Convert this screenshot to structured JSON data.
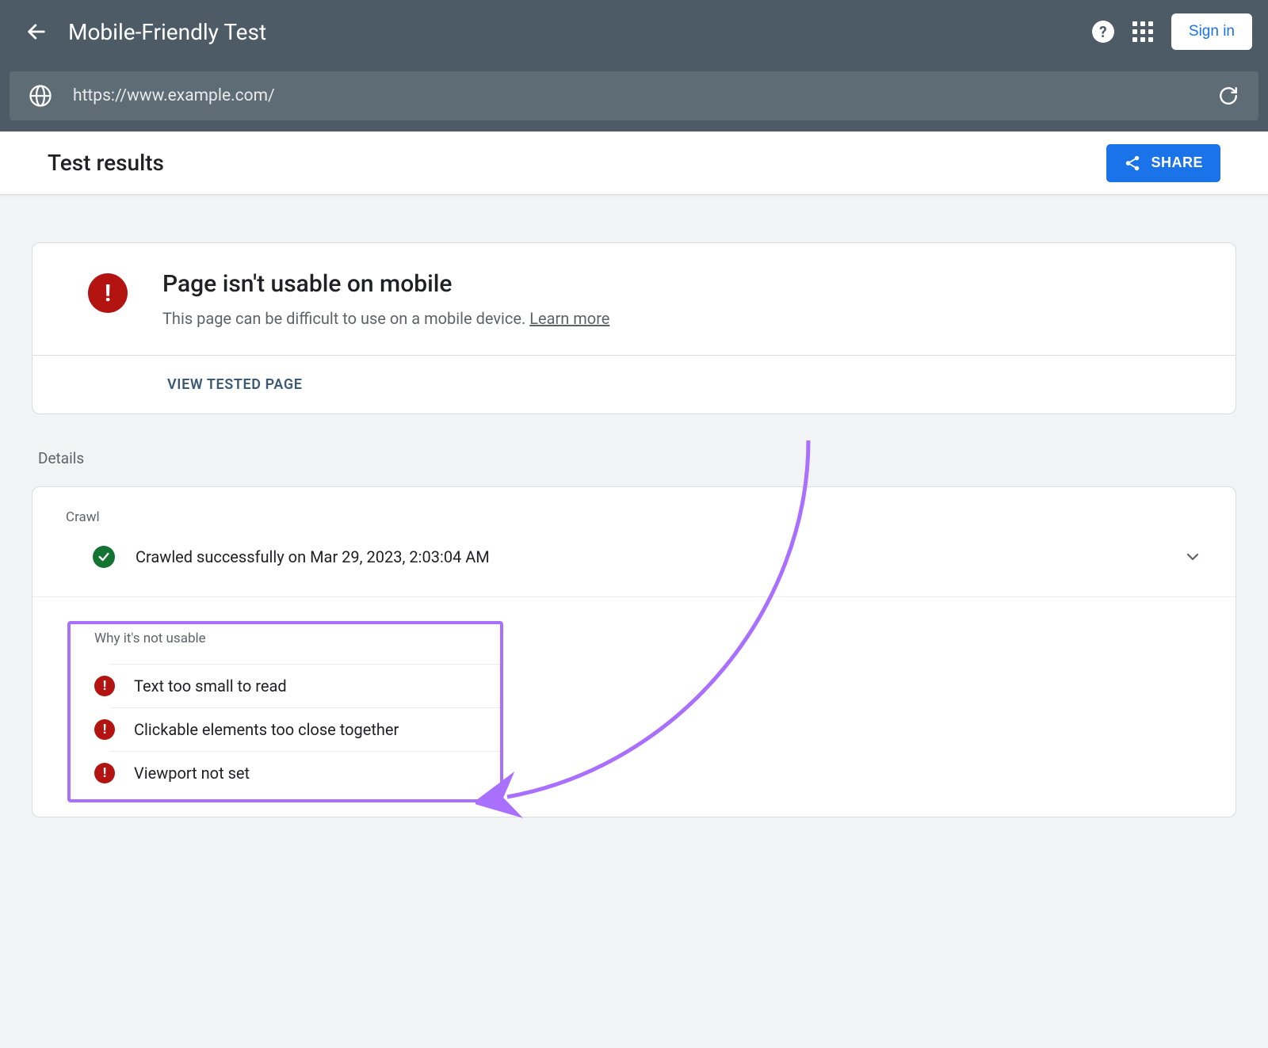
{
  "header": {
    "title": "Mobile-Friendly Test",
    "signin": "Sign in"
  },
  "urlbar": {
    "url": "https://www.example.com/"
  },
  "resultbar": {
    "title": "Test results",
    "share": "SHARE"
  },
  "status_card": {
    "heading": "Page isn't usable on mobile",
    "subtext": "This page can be difficult to use on a mobile device. ",
    "learn_more": "Learn more",
    "view_tested": "VIEW TESTED PAGE"
  },
  "details": {
    "label": "Details",
    "crawl_label": "Crawl",
    "crawl_status": "Crawled successfully on Mar 29, 2023, 2:03:04 AM",
    "why_label": "Why it's not usable",
    "issues": [
      "Text too small to read",
      "Clickable elements too close together",
      "Viewport not set"
    ]
  }
}
